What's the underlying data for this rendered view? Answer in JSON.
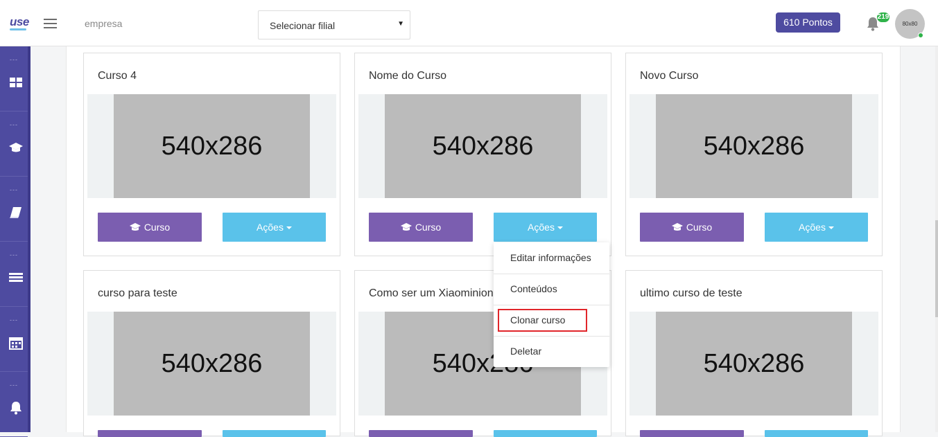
{
  "header": {
    "logo": "use",
    "company_label": "empresa",
    "branch_select": {
      "selected": "Selecionar filial"
    },
    "points": "610 Pontos",
    "notifications_count": "219",
    "avatar_text": "80x80"
  },
  "sidebar": {
    "items": [
      {
        "dots": "---",
        "icon": "dashboard-icon"
      },
      {
        "dots": "---",
        "icon": "graduation-cap-icon"
      },
      {
        "dots": "---",
        "icon": "book-icon"
      },
      {
        "dots": "---",
        "icon": "list-icon"
      },
      {
        "dots": "---",
        "icon": "calendar-icon"
      },
      {
        "dots": "---",
        "icon": "bell-icon"
      }
    ]
  },
  "courses": [
    {
      "title": "Curso 4",
      "image_text": "540x286",
      "course_button": "Curso",
      "actions_button": "Ações"
    },
    {
      "title": "Nome do Curso",
      "image_text": "540x286",
      "course_button": "Curso",
      "actions_button": "Ações"
    },
    {
      "title": "Novo Curso",
      "image_text": "540x286",
      "course_button": "Curso",
      "actions_button": "Ações"
    },
    {
      "title": "curso para teste",
      "image_text": "540x286"
    },
    {
      "title": "Como ser um Xiaominion",
      "image_text": "540x286"
    },
    {
      "title": "ultimo curso de teste",
      "image_text": "540x286"
    }
  ],
  "actions_menu": {
    "items": [
      "Editar informações",
      "Conteúdos",
      "Clonar curso",
      "Deletar"
    ],
    "highlighted": "Clonar curso"
  },
  "colors": {
    "brand": "#4e4ba0",
    "course_button": "#7b5eb0",
    "actions_button": "#5ac2ea",
    "highlight": "#e1252a"
  }
}
